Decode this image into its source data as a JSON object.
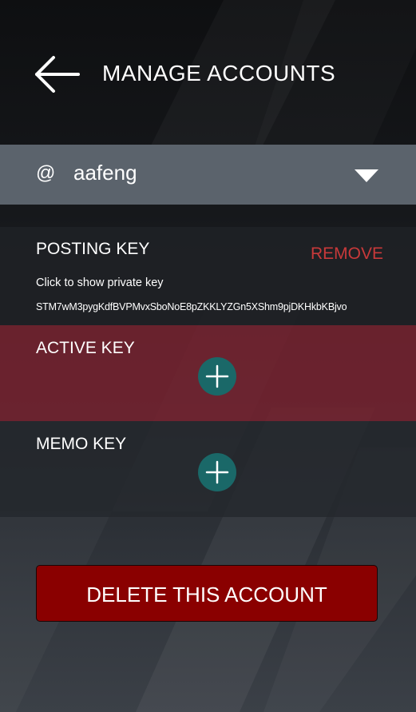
{
  "header": {
    "title": "MANAGE ACCOUNTS",
    "back_icon": "arrow-left-icon"
  },
  "account": {
    "at_symbol": "@",
    "name": "aafeng",
    "dropdown_icon": "caret-down-icon"
  },
  "keys": {
    "posting": {
      "title": "POSTING KEY",
      "remove_label": "REMOVE",
      "show_private_label": "Click to show private key",
      "public_key": "STM7wM3pygKdfBVPMvxSboNoE8pZKKLYZGn5XShm9pjDKHkbKBjvo"
    },
    "active": {
      "title": "ACTIVE KEY",
      "add_icon": "plus-circle-icon"
    },
    "memo": {
      "title": "MEMO KEY",
      "add_icon": "plus-circle-icon"
    }
  },
  "delete_button": {
    "label": "DELETE THIS ACCOUNT"
  },
  "colors": {
    "account_bar": "#5b636c",
    "active_section": "#7a2230",
    "remove_text": "#c8393a",
    "add_button": "#1a6868",
    "delete_button": "#8a0000"
  }
}
